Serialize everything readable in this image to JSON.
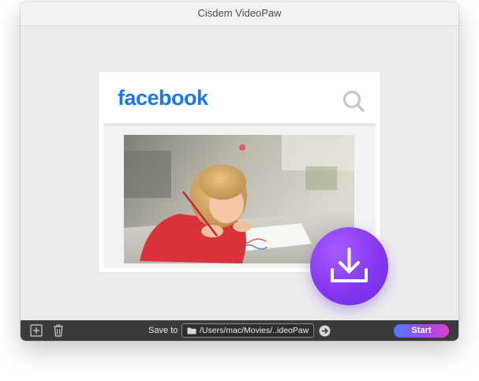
{
  "window": {
    "title": "Cisdem VideoPaw"
  },
  "facebook_card": {
    "logo_text": "facebook",
    "logo_color": "#1877f2",
    "search_icon": "search-icon",
    "image": "photo-child-drawing"
  },
  "download_badge": {
    "icon": "download-icon",
    "color": "#8a3ff2"
  },
  "toolbar": {
    "add_icon": "add-icon",
    "delete_icon": "trash-icon",
    "save_label": "Save to",
    "save_path": "/Users/mac/Movies/..ideoPaw",
    "folder_icon": "folder-icon",
    "go_icon": "arrow-right-circle-icon",
    "start_label": "Start"
  }
}
